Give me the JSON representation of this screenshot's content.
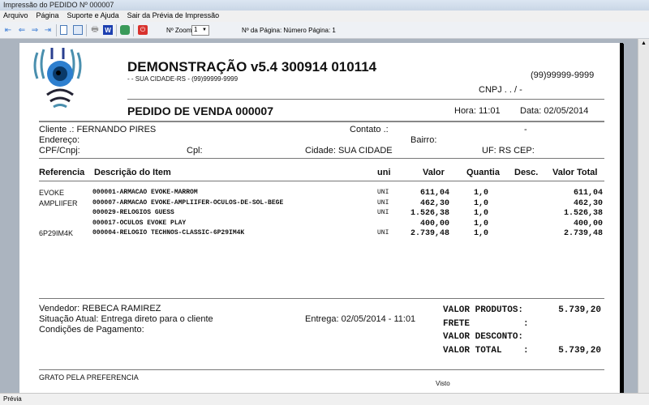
{
  "window": {
    "title": "Impressão do PEDIDO Nº 000007"
  },
  "menu": [
    "Arquivo",
    "Página",
    "Suporte e Ajuda",
    "Sair da Prévia de Impressão"
  ],
  "toolbar": {
    "zoom_label": "Nº Zoom",
    "zoom_value": "1",
    "page_info": "Nº da Página: Número Página: 1"
  },
  "status": "Prévia",
  "doc": {
    "company": "DEMONSTRAÇÃO v5.4 300914 010114",
    "address": "- - SUA CIDADE-RS - (99)99999-9999",
    "phone": "(99)99999-9999",
    "cnpj": "CNPJ .  .  /   -",
    "order_title": "PEDIDO DE VENDA 000007",
    "hora": "Hora: 11:01",
    "data": "Data: 02/05/2014",
    "cliente": "Cliente   .: FERNANDO PIRES",
    "contato": "Contato .:",
    "contato_dash": "-",
    "endereco": "Endereço:",
    "bairro": "Bairro:",
    "cpf": "CPF/Cnpj:",
    "cpl": "Cpl:",
    "cidade": "Cidade: SUA CIDADE",
    "uf": "UF: RS CEP:",
    "columns": [
      "Referencia",
      "Descrição do Item",
      "uni",
      "Valor",
      "Quantia",
      "Desc.",
      "Valor Total"
    ],
    "items": [
      {
        "ref": "EVOKE",
        "desc": "000001-ARMACAO EVOKE-MARROM",
        "uni": "UNI",
        "valor": "611,04",
        "qtd": "1,0",
        "total": "611,04"
      },
      {
        "ref": "AMPLIIFER",
        "desc": "000007-ARMACAO EVOKE-AMPLIIFER-OCULOS-DE-SOL-BEGE",
        "uni": "UNI",
        "valor": "462,30",
        "qtd": "1,0",
        "total": "462,30"
      },
      {
        "ref": "",
        "desc": "000029-RELOGIOS GUESS",
        "uni": "UNI",
        "valor": "1.526,38",
        "qtd": "1,0",
        "total": "1.526,38"
      },
      {
        "ref": "",
        "desc": "000017-OCULOS EVOKE PLAY",
        "uni": "",
        "valor": "400,00",
        "qtd": "1,0",
        "total": "400,00"
      },
      {
        "ref": "6P29IM4K",
        "desc": "000004-RELOGIO TECHNOS-CLASSIC-6P29IM4K",
        "uni": "UNI",
        "valor": "2.739,48",
        "qtd": "1,0",
        "total": "2.739,48"
      }
    ],
    "vendedor": "Vendedor: REBECA RAMIREZ",
    "situacao": "Situação Atual: Entrega direto para o cliente",
    "condicoes": "Condições de Pagamento:",
    "entrega": "Entrega: 02/05/2014 - 11:01",
    "totals": [
      {
        "label": "VALOR PRODUTOS:",
        "value": "5.739,20"
      },
      {
        "label": "FRETE          :",
        "value": ""
      },
      {
        "label": "VALOR DESCONTO:",
        "value": ""
      },
      {
        "label": "VALOR TOTAL    :",
        "value": "5.739,20"
      }
    ],
    "footer": "GRATO PELA PREFERENCIA",
    "visto": "Visto"
  }
}
